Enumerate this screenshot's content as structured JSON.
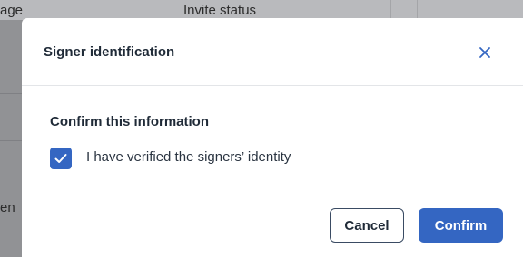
{
  "background": {
    "header_left": "age",
    "header_mid": "Invite status",
    "side_text": "en"
  },
  "modal": {
    "title": "Signer identification",
    "close_icon": "close-icon",
    "section_heading": "Confirm this information",
    "checkbox": {
      "checked": true,
      "label": "I have verified the signers’ identity"
    },
    "buttons": {
      "cancel_label": "Cancel",
      "confirm_label": "Confirm"
    }
  },
  "colors": {
    "accent": "#3466c2",
    "title_text": "#1f2a37",
    "cancel_border": "#3a4b63"
  }
}
